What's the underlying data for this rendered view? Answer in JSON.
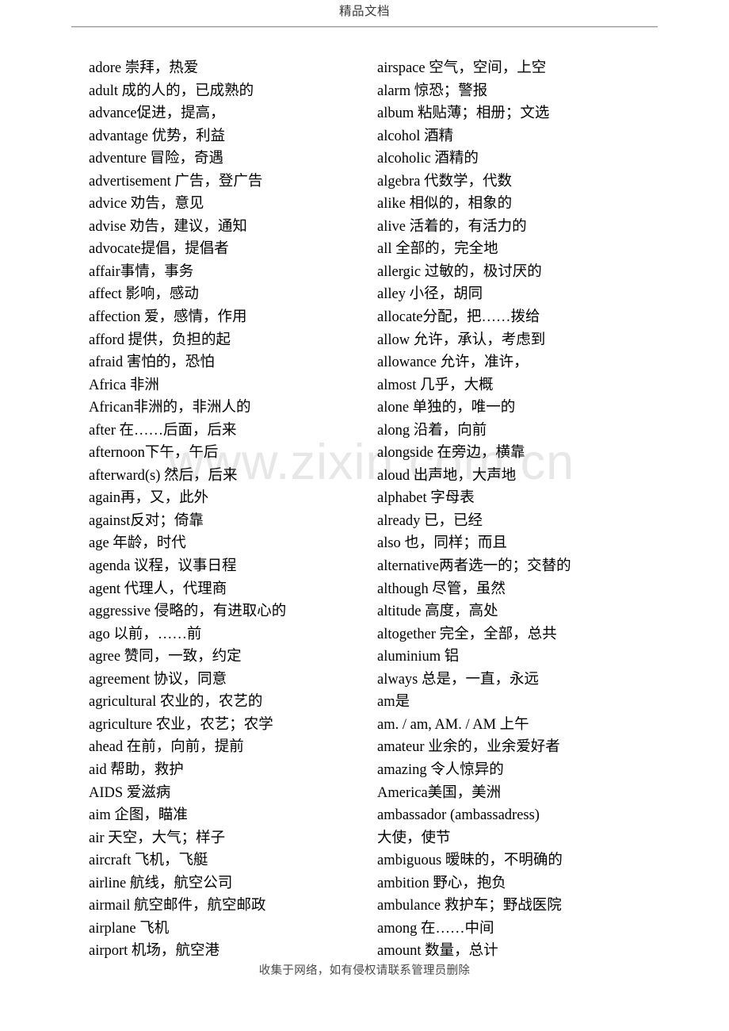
{
  "header": {
    "title": "精品文档"
  },
  "watermark": {
    "text": "www.zixin.com.cn"
  },
  "footer": {
    "text": "收集于网络，如有侵权请联系管理员删除"
  },
  "columns": {
    "left": [
      "adore 崇拜，热爱",
      "adult 成的人的，已成熟的",
      "advance促进，提高，",
      "advantage 优势，利益",
      "adventure 冒险，奇遇",
      "advertisement 广告，登广告",
      "advice 劝告，意见",
      "advise 劝告，建议，通知",
      "advocate提倡，提倡者",
      "affair事情，事务",
      "affect 影响，感动",
      "affection 爱，感情，作用",
      "afford 提供，负担的起",
      "afraid 害怕的，恐怕",
      "Africa 非洲",
      "African非洲的，非洲人的",
      "after 在……后面，后来",
      "afternoon下午，午后",
      "afterward(s) 然后，后来",
      "again再，又，此外",
      "against反对；倚靠",
      "age 年龄，时代",
      "agenda 议程，议事日程",
      "agent 代理人，代理商",
      "aggressive 侵略的，有进取心的",
      "ago 以前，……前",
      "agree 赞同，一致，约定",
      "agreement 协议，同意",
      "agricultural 农业的，农艺的",
      "agriculture 农业，农艺；农学",
      "ahead 在前，向前，提前",
      "aid 帮助，救护",
      "AIDS 爱滋病",
      "aim 企图，瞄准",
      "air 天空，大气；样子",
      "aircraft 飞机，飞艇",
      "airline 航线，航空公司",
      "airmail 航空邮件，航空邮政",
      "airplane 飞机",
      "airport 机场，航空港"
    ],
    "right": [
      "airspace 空气，空间，上空",
      "alarm 惊恐；警报",
      "album 粘贴薄；相册；文选",
      "alcohol 酒精",
      "alcoholic 酒精的",
      "algebra 代数学，代数",
      "alike 相似的，相象的",
      "alive 活着的，有活力的",
      "all 全部的，完全地",
      "allergic 过敏的，极讨厌的",
      "alley 小径，胡同",
      "allocate分配，把……拨给",
      "allow 允许，承认，考虑到",
      "allowance 允许，准许，",
      "almost 几乎，大概",
      "alone 单独的，唯一的",
      "along 沿着，向前",
      "alongside 在旁边，横靠",
      "aloud 出声地，大声地",
      "alphabet 字母表",
      "already 已，已经",
      "also 也，同样；而且",
      "alternative两者选一的；交替的",
      "although 尽管，虽然",
      "altitude 高度，高处",
      "altogether 完全，全部，总共",
      "aluminium 铝",
      "always 总是，一直，永远",
      "am是",
      "am. / am, AM. / AM 上午",
      "amateur 业余的，业余爱好者",
      "amazing 令人惊异的",
      "America美国，美洲",
      "ambassador (ambassadress)",
      "大使，使节",
      "ambiguous 暧昧的，不明确的",
      "ambition 野心，抱负",
      "ambulance 救护车；野战医院",
      "among 在……中间",
      "amount 数量，总计"
    ]
  }
}
